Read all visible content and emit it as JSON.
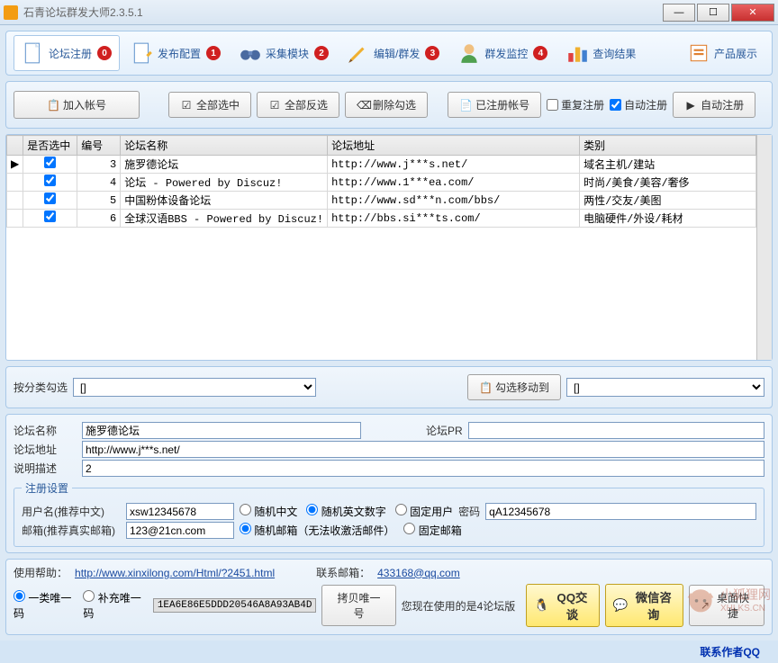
{
  "window": {
    "title": "石青论坛群发大师2.3.5.1"
  },
  "tabs": [
    {
      "label": "论坛注册",
      "badge": "0"
    },
    {
      "label": "发布配置",
      "badge": "1"
    },
    {
      "label": "采集模块",
      "badge": "2"
    },
    {
      "label": "编辑/群发",
      "badge": "3"
    },
    {
      "label": "群发监控",
      "badge": "4"
    },
    {
      "label": "查询结果",
      "badge": ""
    },
    {
      "label": "产品展示",
      "badge": ""
    }
  ],
  "toolbar": {
    "add": "加入帐号",
    "select_all": "全部选中",
    "invert": "全部反选",
    "delete_sel": "删除勾选",
    "registered": "已注册帐号",
    "repeat_reg": "重复注册",
    "auto_reg": "自动注册",
    "auto_reg_btn": "自动注册"
  },
  "grid": {
    "headers": {
      "sel": "是否选中",
      "id": "编号",
      "name": "论坛名称",
      "url": "论坛地址",
      "cat": "类别"
    },
    "rows": [
      {
        "sel": true,
        "id": "3",
        "name": "施罗德论坛",
        "url": "http://www.j***s.net/",
        "cat": "域名主机/建站"
      },
      {
        "sel": true,
        "id": "4",
        "name": "论坛  - Powered by Discuz!",
        "url": "http://www.1***ea.com/",
        "cat": "时尚/美食/美容/奢侈"
      },
      {
        "sel": true,
        "id": "5",
        "name": "中国粉体设备论坛",
        "url": "http://www.sd***n.com/bbs/",
        "cat": "两性/交友/美图"
      },
      {
        "sel": true,
        "id": "6",
        "name": " 全球汉语BBS  - Powered by Discuz!",
        "url": "http://bbs.si***ts.com/",
        "cat": "电脑硬件/外设/耗材"
      }
    ]
  },
  "filter": {
    "label": "按分类勾选",
    "opt": "[]",
    "move_label": "勾选移动到",
    "opt2": "[]"
  },
  "detail": {
    "name_lbl": "论坛名称",
    "name_val": "施罗德论坛",
    "pr_lbl": "论坛PR",
    "pr_val": "",
    "url_lbl": "论坛地址",
    "url_val": "http://www.j***s.net/",
    "desc_lbl": "说明描述",
    "desc_val": "2"
  },
  "reg": {
    "legend": "注册设置",
    "user_lbl": "用户名(推荐中文)",
    "user_val": "xsw12345678",
    "rand_cn": "随机中文",
    "rand_en": "随机英文数字",
    "fixed_user": "固定用户",
    "pwd_lbl": "密码",
    "pwd_val": "qA12345678",
    "mail_lbl": "邮箱(推荐真实邮箱)",
    "mail_val": "123@21cn.com",
    "rand_mail": "随机邮箱（无法收激活邮件）",
    "fixed_mail": "固定邮箱"
  },
  "footer": {
    "help_lbl": "使用帮助：",
    "help_url": "http://www.xinxilong.com/Html/?2451.html",
    "contact_lbl": "联系邮箱：",
    "contact_mail": "433168@qq.com",
    "code1_lbl": "一类唯一码",
    "code2_lbl": "补充唯一码",
    "code_val": "1EA6E86E5DDD20546A8A93AB4D",
    "copy_btn": "拷贝唯一号",
    "version_msg": "您现在使用的是4论坛版",
    "qq_talk": "QQ交谈",
    "wechat": "微信咨询",
    "desktop": "桌面快捷"
  },
  "status": {
    "author": "联系作者QQ"
  },
  "watermark": {
    "brand": "小狐狸网",
    "url": "XHLKS.CN"
  }
}
